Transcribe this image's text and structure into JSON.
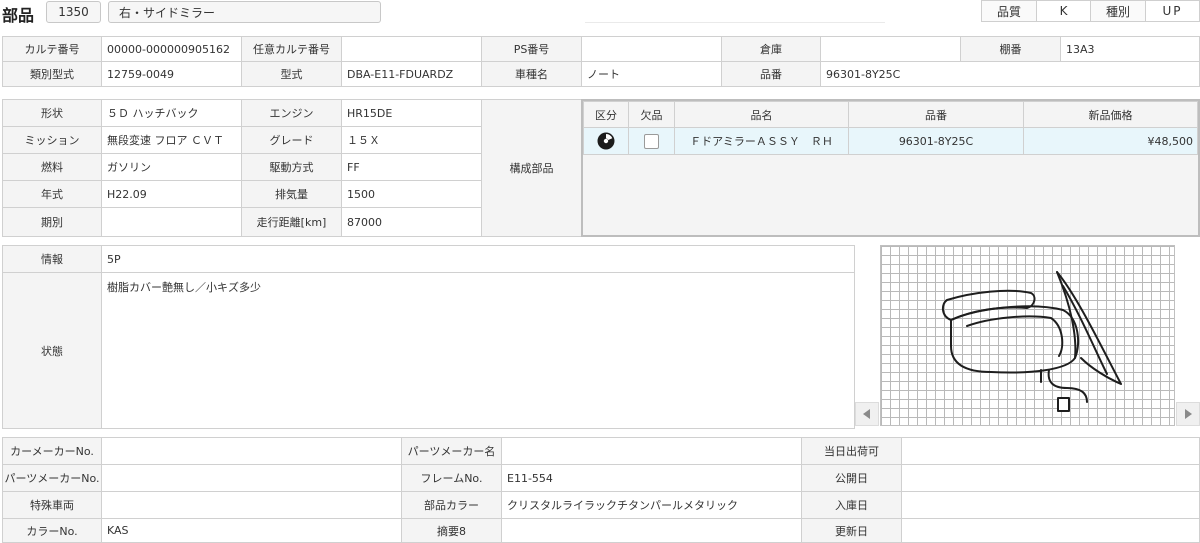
{
  "header": {
    "title": "部品",
    "code": "1350",
    "part_name": "右・サイドミラー",
    "quality_label": "品質",
    "quality_value": "K",
    "type_label": "種別",
    "type_value": "UP"
  },
  "info1": {
    "karte_no_label": "カルテ番号",
    "karte_no": "00000-000000905162",
    "opt_karte_label": "任意カルテ番号",
    "opt_karte": "",
    "ps_label": "PS番号",
    "ps": "",
    "warehouse_label": "倉庫",
    "warehouse": "",
    "shelf_label": "棚番",
    "shelf": "13A3",
    "class_label": "類別型式",
    "class": "12759-0049",
    "model_label": "型式",
    "model": "DBA-E11-FDUARDZ",
    "car_label": "車種名",
    "car": "ノート",
    "partno_label": "品番",
    "partno": "96301-8Y25C"
  },
  "vehicle": {
    "shape_label": "形状",
    "shape": "５Ｄ ハッチバック",
    "engine_label": "エンジン",
    "engine": "HR15DE",
    "mission_label": "ミッション",
    "mission": "無段変速 フロア ＣＶＴ",
    "grade_label": "グレード",
    "grade": "１５Ｘ",
    "fuel_label": "燃料",
    "fuel": "ガソリン",
    "drive_label": "駆動方式",
    "drive": "FF",
    "year_label": "年式",
    "year": "H22.09",
    "displacement_label": "排気量",
    "displacement": "1500",
    "period_label": "期別",
    "period": "",
    "mileage_label": "走行距離[km]",
    "mileage": "87000"
  },
  "components": {
    "label": "構成部品",
    "columns": [
      "区分",
      "欠品",
      "品名",
      "品番",
      "新品価格"
    ],
    "rows": [
      {
        "name": "ＦドアミラーＡＳＳＹ　ＲＨ",
        "partno": "96301-8Y25C",
        "price": "¥48,500"
      }
    ]
  },
  "notes": {
    "info_label": "情報",
    "info": "5P",
    "condition_label": "状態",
    "condition": "樹脂カバー艶無し／小キズ多少"
  },
  "bottom": {
    "car_maker_no_label": "カーメーカーNo.",
    "car_maker_no": "",
    "parts_maker_name_label": "パーツメーカー名",
    "parts_maker_name": "",
    "same_day_label": "当日出荷可",
    "same_day": "",
    "parts_maker_no_label": "パーツメーカーNo.",
    "parts_maker_no": "",
    "frame_label": "フレームNo.",
    "frame": "E11-554",
    "public_date_label": "公開日",
    "public_date": "",
    "special_label": "特殊車両",
    "special": "",
    "part_color_label": "部品カラー",
    "part_color": "クリスタルライラックチタンパールメタリック",
    "stock_date_label": "入庫日",
    "stock_date": "",
    "color_no_label": "カラーNo.",
    "color_no": "KAS",
    "summary_label": "摘要8",
    "summary": "",
    "update_label": "更新日",
    "update": ""
  },
  "icons": {
    "gallery_prev": "chevron-left-icon",
    "gallery_next": "chevron-right-icon",
    "category": "disc-icon",
    "missing": "checkbox-icon"
  }
}
